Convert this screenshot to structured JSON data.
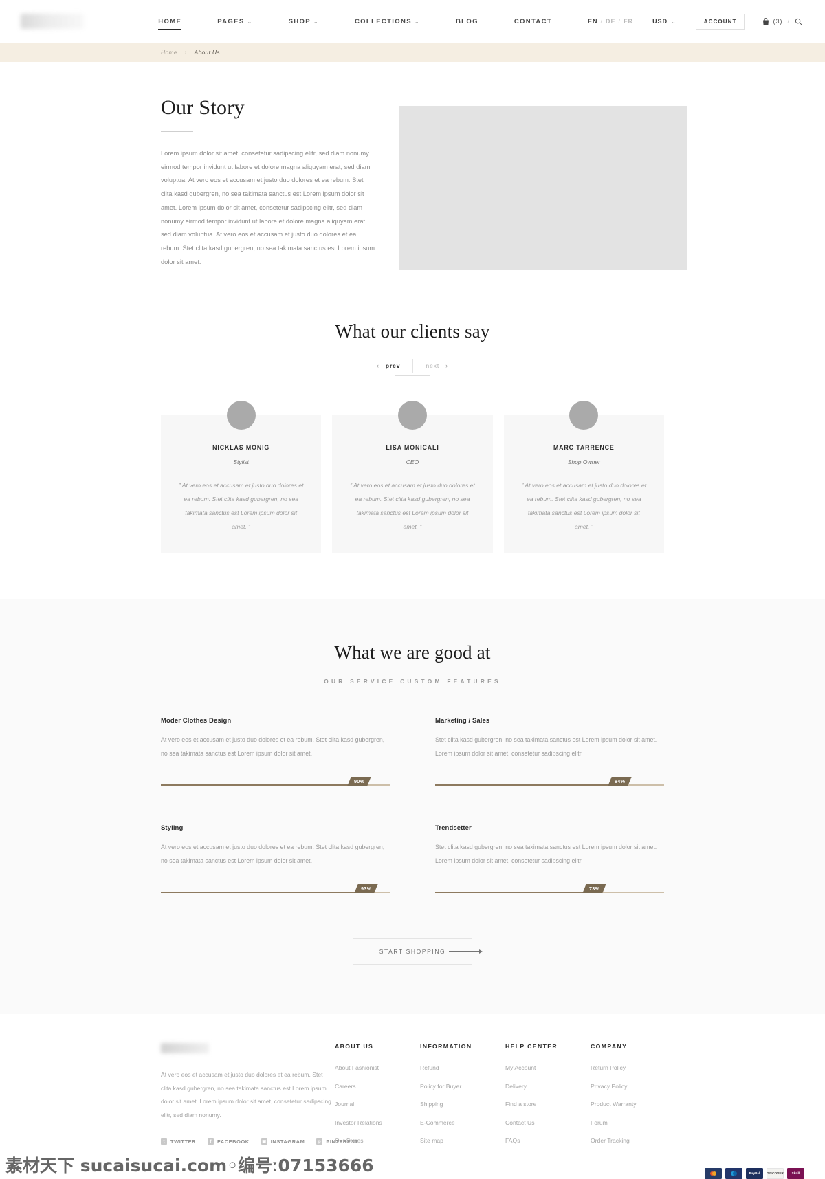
{
  "header": {
    "logo_alt": "site-logo",
    "nav": [
      {
        "label": "HOME",
        "caret": "",
        "active": true
      },
      {
        "label": "PAGES",
        "caret": "⌄",
        "active": false
      },
      {
        "label": "SHOP",
        "caret": "⌄",
        "active": false
      },
      {
        "label": "COLLECTIONS",
        "caret": "⌄",
        "active": false
      },
      {
        "label": "BLOG",
        "caret": "",
        "active": false
      },
      {
        "label": "CONTACT",
        "caret": "",
        "active": false
      }
    ],
    "languages": {
      "active": "EN",
      "second": "DE",
      "third": "FR",
      "separator": "/"
    },
    "currency": {
      "label": "USD",
      "caret": "⌄"
    },
    "account_label": "ACCOUNT",
    "cart_count": "(3)",
    "cart_slash": "/",
    "icons": {
      "bag": "bag-icon",
      "search": "search-icon"
    }
  },
  "breadcrumb": {
    "home": "Home",
    "arrow": "›",
    "current": "About Us"
  },
  "story": {
    "title": "Our Story",
    "body": "Lorem ipsum dolor sit amet, consetetur sadipscing elitr, sed diam nonumy eirmod tempor invidunt ut labore et dolore magna aliquyam erat, sed diam voluptua. At vero eos et accusam et justo duo dolores et ea rebum. Stet clita kasd gubergren, no sea takimata sanctus est Lorem ipsum dolor sit amet. Lorem ipsum dolor sit amet, consetetur sadipscing elitr, sed diam nonumy eirmod tempor invidunt ut labore et dolore magna aliquyam erat, sed diam voluptua. At vero eos et accusam et justo duo dolores et ea rebum. Stet clita kasd gubergren, no sea takimata sanctus est Lorem ipsum dolor sit amet."
  },
  "testimonials": {
    "title": "What our clients say",
    "prev_label": "prev",
    "next_label": "next",
    "prev_chevron": "‹",
    "next_chevron": "›",
    "items": [
      {
        "name": "NICKLAS MONIG",
        "role": "Stylist",
        "quote": "” At vero eos et accusam et justo duo dolores et ea rebum. Stet clita kasd gubergren, no sea takimata sanctus est Lorem ipsum dolor sit amet. ”"
      },
      {
        "name": "LISA MONICALI",
        "role": "CEO",
        "quote": "” At vero eos et accusam et justo duo dolores et ea rebum. Stet clita kasd gubergren, no sea takimata sanctus est Lorem ipsum dolor sit amet. ”"
      },
      {
        "name": "MARC TARRENCE",
        "role": "Shop Owner",
        "quote": "” At vero eos et accusam et justo duo dolores et ea rebum. Stet clita kasd gubergren, no sea takimata sanctus est Lorem ipsum dolor sit amet. ”"
      }
    ]
  },
  "skills": {
    "title": "What we are good at",
    "subtitle": "OUR SERVICE CUSTOM FEATURES",
    "items": [
      {
        "name": "Moder Clothes Design",
        "description": "At vero eos et accusam et justo duo dolores et ea rebum. Stet clita kasd gubergren, no sea takimata sanctus est Lorem ipsum dolor sit amet.",
        "percent": 90,
        "percent_label": "90%"
      },
      {
        "name": "Marketing / Sales",
        "description": "Stet clita kasd gubergren, no sea takimata sanctus est Lorem ipsum dolor sit amet. Lorem ipsum dolor sit amet, consetetur sadipscing elitr.",
        "percent": 84,
        "percent_label": "84%"
      },
      {
        "name": "Styling",
        "description": "At vero eos et accusam et justo duo dolores et ea rebum. Stet clita kasd gubergren, no sea takimata sanctus est Lorem ipsum dolor sit amet.",
        "percent": 93,
        "percent_label": "93%"
      },
      {
        "name": "Trendsetter",
        "description": "Stet clita kasd gubergren, no sea takimata sanctus est Lorem ipsum dolor sit amet. Lorem ipsum dolor sit amet, consetetur sadipscing elitr.",
        "percent": 73,
        "percent_label": "73%"
      }
    ],
    "cta_label": "START SHOPPING"
  },
  "footer": {
    "brand_text": " At vero eos et accusam et justo duo dolores et ea rebum. Stet clita kasd gubergren, no sea takimata sanctus est Lorem ipsum dolor sit amet. Lorem ipsum dolor sit amet, consetetur sadipscing elitr, sed diam nonumy.",
    "socials": [
      {
        "label": "TWITTER",
        "glyph": "t",
        "icon": "twitter-icon"
      },
      {
        "label": "FACEBOOK",
        "glyph": "f",
        "icon": "facebook-icon"
      },
      {
        "label": "INSTAGRAM",
        "glyph": "▣",
        "icon": "instagram-icon"
      },
      {
        "label": "PINTEREST",
        "glyph": "p",
        "icon": "pinterest-icon"
      }
    ],
    "columns": [
      {
        "title": "ABOUT US",
        "links": [
          "About Fashionist",
          "Careers",
          "Journal",
          "Investor Relations",
          "Our Stores"
        ]
      },
      {
        "title": "INFORMATION",
        "links": [
          "Refund",
          "Policy for Buyer",
          "Shipping",
          "E-Commerce",
          "Site map"
        ]
      },
      {
        "title": "HELP CENTER",
        "links": [
          "My Account",
          "Delivery",
          "Find a store",
          "Contact Us",
          "FAQs"
        ]
      },
      {
        "title": "COMPANY",
        "links": [
          "Return Policy",
          "Privacy Policy",
          "Product Warranty",
          "Forum",
          "Order Tracking"
        ]
      }
    ],
    "payments": [
      {
        "name": "Mastercard",
        "key": "mc"
      },
      {
        "name": "Maestro",
        "key": "maestro"
      },
      {
        "name": "PayPal",
        "key": "paypal"
      },
      {
        "name": "DISCOVER",
        "key": "discover"
      },
      {
        "name": "Skrill",
        "key": "skrill"
      }
    ]
  },
  "watermark": {
    "text": "素材天下 sucaisucai.com◦编号ː07153666"
  },
  "colors": {
    "breadcrumb_bg": "#f5eee2",
    "skills_bg": "#fafafa",
    "card_bg": "#f7f7f7",
    "bar_fill": "#8d7a5f",
    "bar_track": "#cdbfa9",
    "bar_tag": "#7a6a51",
    "placeholder": "#e3e3e3"
  }
}
